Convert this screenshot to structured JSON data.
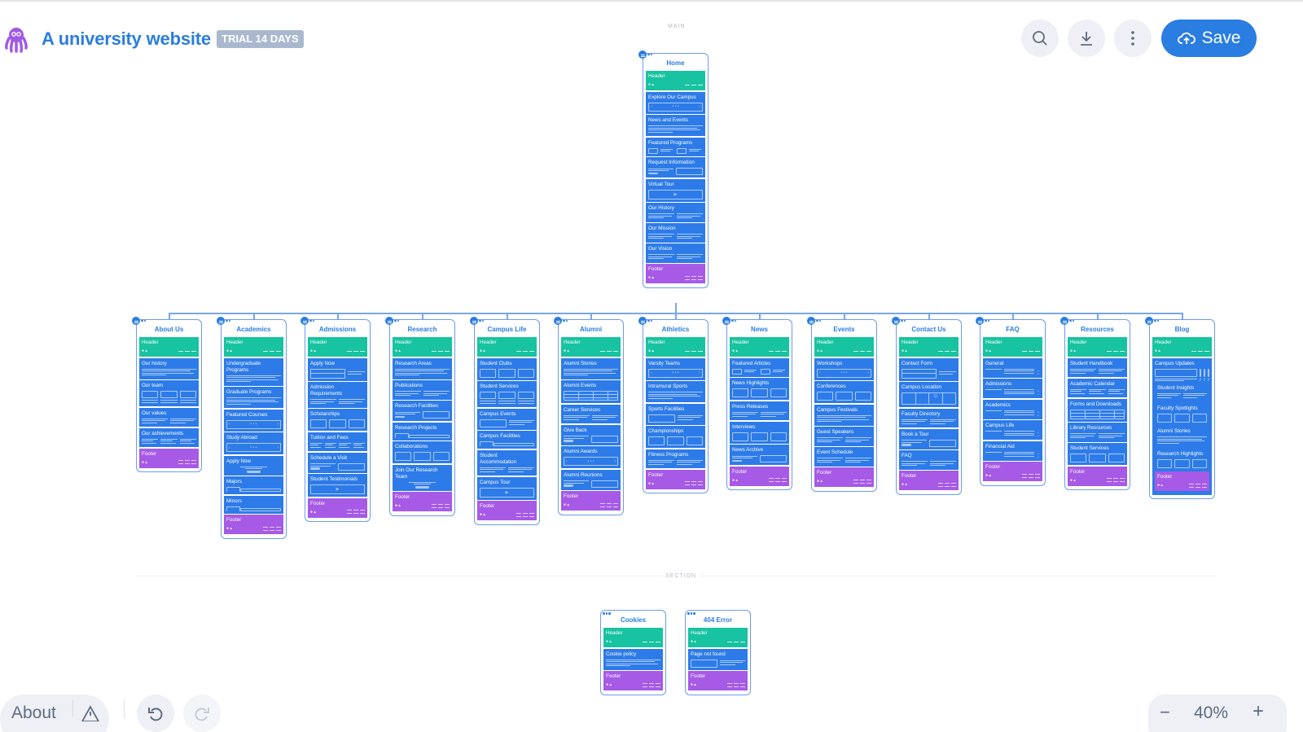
{
  "app": {
    "title": "A university website",
    "badge": "TRIAL 14 DAYS",
    "logo": "octopus-logo"
  },
  "toolbar": {
    "search_icon": "search-icon",
    "download_icon": "download-icon",
    "more_icon": "more-vertical-icon",
    "save_label": "Save",
    "save_icon": "cloud-upload-icon"
  },
  "canvas": {
    "main_label": "MAIN",
    "section_label": "SECTION"
  },
  "bottom_bar": {
    "about_label": "About",
    "warning_icon": "warning-icon",
    "undo_icon": "undo-icon",
    "redo_icon": "redo-icon",
    "zoom_out": "−",
    "zoom_level": "40%",
    "zoom_in": "+"
  },
  "colors": {
    "accent": "#2a7de1",
    "header_block": "#17c3a0",
    "content_block": "#2d7be8",
    "footer_block": "#a65ae6",
    "badge": "#aab8cf"
  },
  "home": {
    "title": "Home",
    "blocks": [
      {
        "label": "Header",
        "kind": "header"
      },
      {
        "label": "Explore Our Campus",
        "kind": "carousel"
      },
      {
        "label": "News and Events",
        "kind": "text"
      },
      {
        "label": "Featured Programs",
        "kind": "media"
      },
      {
        "label": "Request Information",
        "kind": "cta"
      },
      {
        "label": "Virtual Tour",
        "kind": "video"
      },
      {
        "label": "Our History",
        "kind": "text2"
      },
      {
        "label": "Our Mission",
        "kind": "text2"
      },
      {
        "label": "Our Vision",
        "kind": "text2"
      },
      {
        "label": "Footer",
        "kind": "footer"
      }
    ]
  },
  "pages": [
    {
      "title": "About Us",
      "blocks": [
        {
          "label": "Header",
          "kind": "header"
        },
        {
          "label": "Our history",
          "kind": "text"
        },
        {
          "label": "Our team",
          "kind": "people"
        },
        {
          "label": "Our values",
          "kind": "text2"
        },
        {
          "label": "Our achievements",
          "kind": "text3"
        },
        {
          "label": "Footer",
          "kind": "footer"
        }
      ]
    },
    {
      "title": "Academics",
      "blocks": [
        {
          "label": "Header",
          "kind": "header"
        },
        {
          "label": "Undergraduate Programs",
          "kind": "text"
        },
        {
          "label": "Graduate Programs",
          "kind": "text"
        },
        {
          "label": "Featured Courses",
          "kind": "carousel"
        },
        {
          "label": "Study Abroad",
          "kind": "carousel"
        },
        {
          "label": "Apply Now",
          "kind": "ctacenter"
        },
        {
          "label": "Majors",
          "kind": "tabs"
        },
        {
          "label": "Minors",
          "kind": "tabs"
        },
        {
          "label": "Footer",
          "kind": "footer"
        }
      ]
    },
    {
      "title": "Admissions",
      "blocks": [
        {
          "label": "Header",
          "kind": "header"
        },
        {
          "label": "Apply Now",
          "kind": "form"
        },
        {
          "label": "Admission Requirements",
          "kind": "text2"
        },
        {
          "label": "Scholarships",
          "kind": "gallery"
        },
        {
          "label": "Tuition and Fees",
          "kind": "text4"
        },
        {
          "label": "Schedule a Visit",
          "kind": "cta"
        },
        {
          "label": "Student Testimonials",
          "kind": "video"
        },
        {
          "label": "Footer",
          "kind": "footer"
        }
      ]
    },
    {
      "title": "Research",
      "blocks": [
        {
          "label": "Header",
          "kind": "header"
        },
        {
          "label": "Research Areas",
          "kind": "text"
        },
        {
          "label": "Publications",
          "kind": "text2"
        },
        {
          "label": "Research Facilities",
          "kind": "cta"
        },
        {
          "label": "Research Projects",
          "kind": "tabs"
        },
        {
          "label": "Collaborations",
          "kind": "gallery"
        },
        {
          "label": "Join Our Research Team",
          "kind": "ctacenter"
        },
        {
          "label": "Footer",
          "kind": "footer"
        }
      ]
    },
    {
      "title": "Campus Life",
      "blocks": [
        {
          "label": "Header",
          "kind": "header"
        },
        {
          "label": "Student Clubs",
          "kind": "gallery"
        },
        {
          "label": "Student Services",
          "kind": "people"
        },
        {
          "label": "Campus Events",
          "kind": "mediarev"
        },
        {
          "label": "Campus Facilities",
          "kind": "tabs"
        },
        {
          "label": "Student Accommodation",
          "kind": "text2"
        },
        {
          "label": "Campus Tour",
          "kind": "video"
        },
        {
          "label": "Footer",
          "kind": "footer"
        }
      ]
    },
    {
      "title": "Alumni",
      "blocks": [
        {
          "label": "Header",
          "kind": "header"
        },
        {
          "label": "Alumni Stories",
          "kind": "text"
        },
        {
          "label": "Alumni Events",
          "kind": "table"
        },
        {
          "label": "Career Services",
          "kind": "text2"
        },
        {
          "label": "Give Back",
          "kind": "cta"
        },
        {
          "label": "Alumni Awards",
          "kind": "carousel"
        },
        {
          "label": "Alumni Reunions",
          "kind": "cta"
        },
        {
          "label": "Footer",
          "kind": "footer"
        }
      ]
    },
    {
      "title": "Athletics",
      "blocks": [
        {
          "label": "Header",
          "kind": "header"
        },
        {
          "label": "Varsity Teams",
          "kind": "carousel"
        },
        {
          "label": "Intramural Sports",
          "kind": "text"
        },
        {
          "label": "Sports Facilities",
          "kind": "mediarev"
        },
        {
          "label": "Championships",
          "kind": "gallery"
        },
        {
          "label": "Fitness Programs",
          "kind": "text2"
        },
        {
          "label": "Footer",
          "kind": "footer"
        }
      ]
    },
    {
      "title": "News",
      "blocks": [
        {
          "label": "Header",
          "kind": "header"
        },
        {
          "label": "Featured Articles",
          "kind": "media"
        },
        {
          "label": "News Highlights",
          "kind": "gallery"
        },
        {
          "label": "Press Releases",
          "kind": "text2"
        },
        {
          "label": "Interviews",
          "kind": "gallery"
        },
        {
          "label": "News Archive",
          "kind": "cta"
        },
        {
          "label": "Footer",
          "kind": "footer"
        }
      ]
    },
    {
      "title": "Events",
      "blocks": [
        {
          "label": "Header",
          "kind": "header"
        },
        {
          "label": "Workshops",
          "kind": "carousel"
        },
        {
          "label": "Conferences",
          "kind": "gallery"
        },
        {
          "label": "Campus Festivals",
          "kind": "text"
        },
        {
          "label": "Guest Speakers",
          "kind": "text2"
        },
        {
          "label": "Event Schedule",
          "kind": "text2"
        },
        {
          "label": "Footer",
          "kind": "footer"
        }
      ]
    },
    {
      "title": "Contact Us",
      "blocks": [
        {
          "label": "Header",
          "kind": "header"
        },
        {
          "label": "Contact Form",
          "kind": "form"
        },
        {
          "label": "Campus Location",
          "kind": "map"
        },
        {
          "label": "Faculty Directory",
          "kind": "text2"
        },
        {
          "label": "Book a Tour",
          "kind": "cta"
        },
        {
          "label": "FAQ",
          "kind": "text2"
        },
        {
          "label": "Footer",
          "kind": "footer"
        }
      ]
    },
    {
      "title": "FAQ",
      "blocks": [
        {
          "label": "Header",
          "kind": "header"
        },
        {
          "label": "General",
          "kind": "faq"
        },
        {
          "label": "Admissions",
          "kind": "faq"
        },
        {
          "label": "Academics",
          "kind": "faq"
        },
        {
          "label": "Campus Life",
          "kind": "faq"
        },
        {
          "label": "Financial Aid",
          "kind": "faq"
        },
        {
          "label": "Footer",
          "kind": "footer"
        }
      ]
    },
    {
      "title": "Resources",
      "blocks": [
        {
          "label": "Header",
          "kind": "header"
        },
        {
          "label": "Student Handbook",
          "kind": "text2"
        },
        {
          "label": "Academic Calendar",
          "kind": "text3"
        },
        {
          "label": "Forms and Downloads",
          "kind": "table"
        },
        {
          "label": "Library Resources",
          "kind": "text2"
        },
        {
          "label": "Student Services",
          "kind": "gallery"
        },
        {
          "label": "Footer",
          "kind": "footer"
        }
      ]
    },
    {
      "title": "Blog",
      "blocks": [
        {
          "label": "Header",
          "kind": "header"
        },
        {
          "label": "Campus Updates",
          "kind": "cards3"
        },
        {
          "label": "Student Insights",
          "kind": "text2"
        },
        {
          "label": "Faculty Spotlights",
          "kind": "gallery"
        },
        {
          "label": "Alumni Stories",
          "kind": "text"
        },
        {
          "label": "Research Highlights",
          "kind": "gallery"
        },
        {
          "label": "Footer",
          "kind": "footer"
        }
      ]
    }
  ],
  "section_pages": [
    {
      "title": "Cookies",
      "blocks": [
        {
          "label": "Header",
          "kind": "header"
        },
        {
          "label": "Cookie policy",
          "kind": "text"
        },
        {
          "label": "Footer",
          "kind": "footer"
        }
      ]
    },
    {
      "title": "404 Error",
      "blocks": [
        {
          "label": "Header",
          "kind": "header"
        },
        {
          "label": "Page not found",
          "kind": "mediarev"
        },
        {
          "label": "Footer",
          "kind": "footer"
        }
      ]
    }
  ]
}
